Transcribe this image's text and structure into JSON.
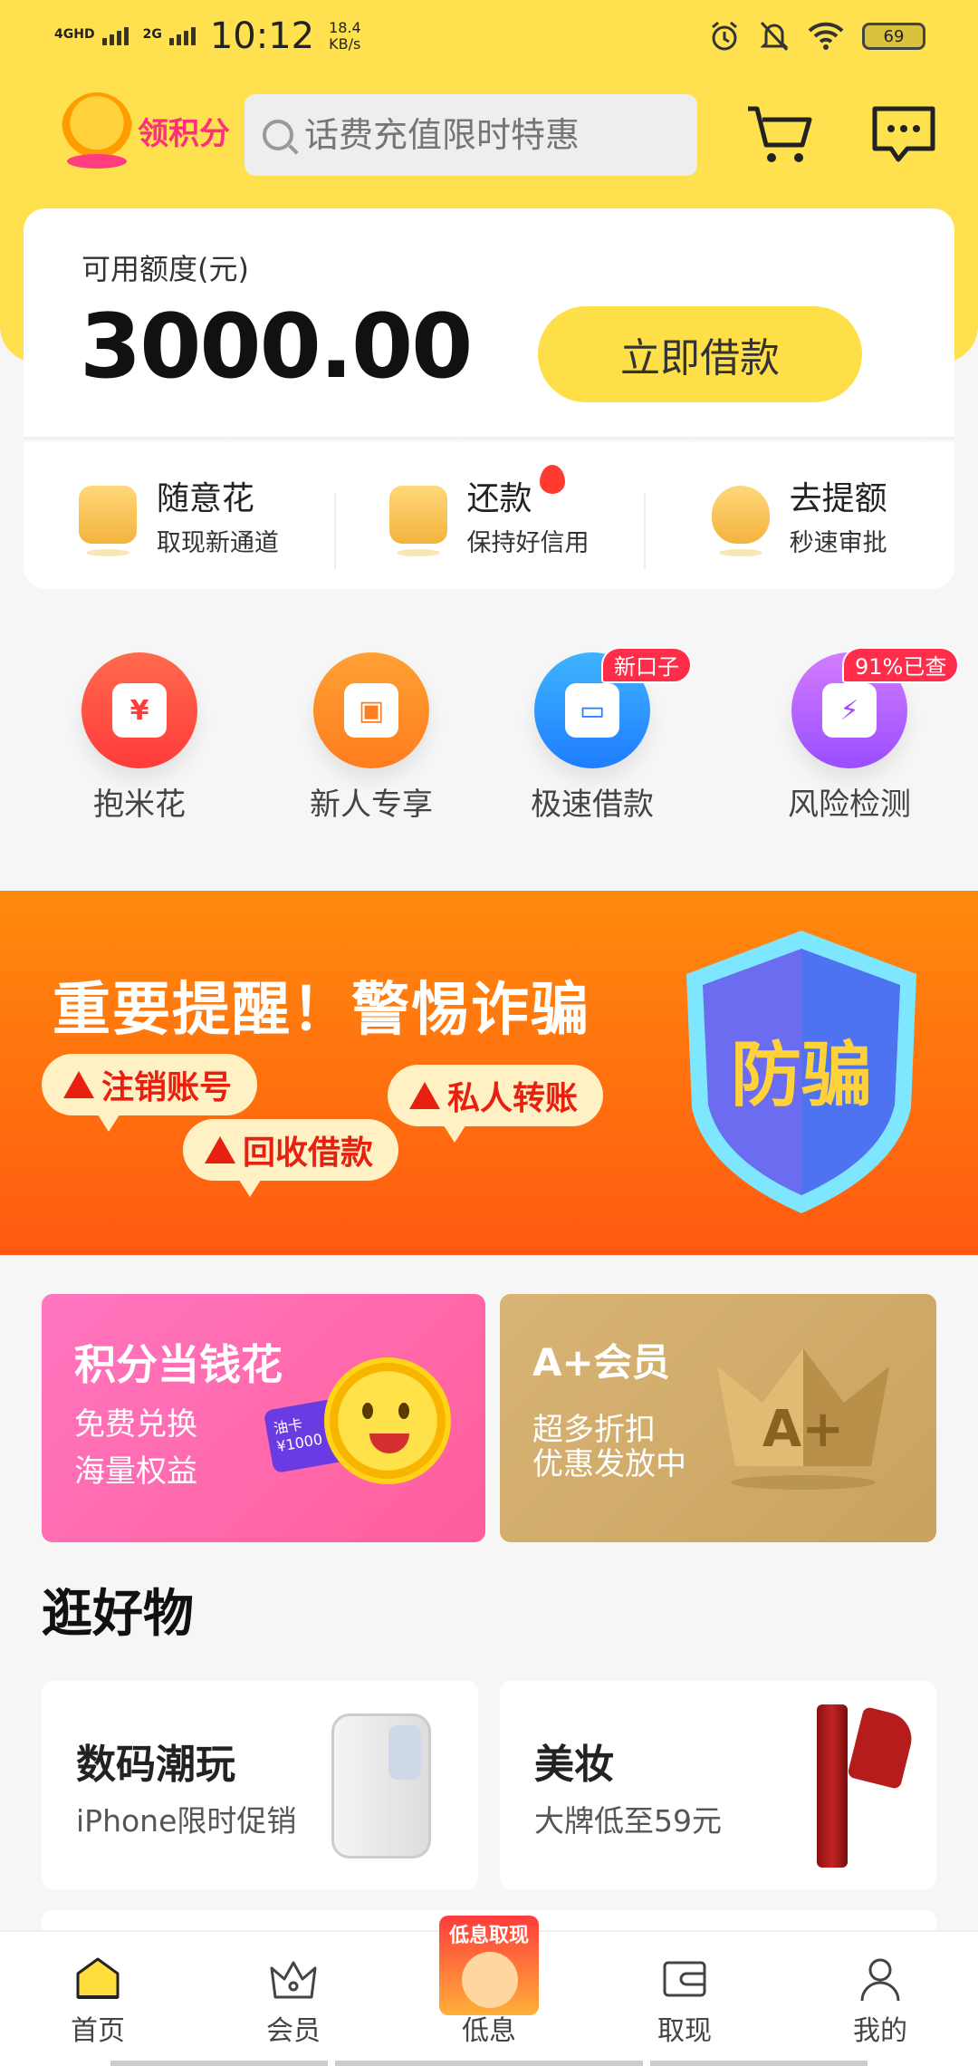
{
  "status_bar": {
    "network1": "4GHD",
    "network2": "2G",
    "time": "10:12",
    "speed_value": "18.4",
    "speed_unit": "KB/s",
    "battery": "69"
  },
  "header": {
    "points_label": "领积分",
    "search_placeholder": "话费充值限时特惠"
  },
  "credit": {
    "label": "可用额度(元)",
    "amount": "3000.00",
    "borrow_button": "立即借款"
  },
  "quick_actions": [
    {
      "title": "随意花",
      "subtitle": "取现新通道"
    },
    {
      "title": "还款",
      "subtitle": "保持好信用"
    },
    {
      "title": "去提额",
      "subtitle": "秒速审批"
    }
  ],
  "services": [
    {
      "label": "抱米花",
      "glyph": "¥",
      "color_from": "#ff6a4d",
      "color_to": "#ff3b3b"
    },
    {
      "label": "新人专享",
      "glyph": "▣",
      "color_from": "#ffa033",
      "color_to": "#ff7d1f"
    },
    {
      "label": "极速借款",
      "glyph": "▭",
      "color_from": "#3fb4ff",
      "color_to": "#1e7dff",
      "badge": "新口子"
    },
    {
      "label": "风险检测",
      "glyph": "⚡",
      "color_from": "#d27dff",
      "color_to": "#9a4dff",
      "badge": "91%已查"
    }
  ],
  "banner": {
    "title": "重要提醒！警惕诈骗",
    "bubbles": [
      "注销账号",
      "私人转账",
      "回收借款"
    ],
    "shield_text": "防骗"
  },
  "promos": [
    {
      "title": "积分当钱花",
      "lines": [
        "免费兑换",
        "海量权益"
      ],
      "card_label": "油卡",
      "card_value": "¥1000"
    },
    {
      "title": "A+会员",
      "lines": [
        "超多折扣",
        "优惠发放中"
      ],
      "emblem": "A+"
    }
  ],
  "section": {
    "title": "逛好物"
  },
  "goods": [
    {
      "title": "数码潮玩",
      "subtitle": "iPhone限时促销"
    },
    {
      "title": "美妆",
      "subtitle": "大牌低至59元"
    }
  ],
  "nav": {
    "items": [
      {
        "label": "首页"
      },
      {
        "label": "会员"
      },
      {
        "label": "低息"
      },
      {
        "label": "取现"
      },
      {
        "label": "我的"
      }
    ],
    "center_promo": "低息取现"
  },
  "colors": {
    "brand_yellow": "#ffe14f",
    "banner_orange": "#ff7a10",
    "badge_red": "#ff2d4a"
  }
}
